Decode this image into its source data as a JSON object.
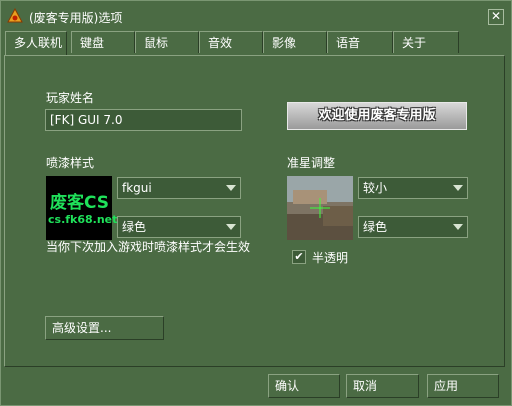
{
  "window": {
    "title": "(废客专用版)选项",
    "close_glyph": "✕"
  },
  "tabs": [
    {
      "label": "多人联机",
      "active": true
    },
    {
      "label": "键盘"
    },
    {
      "label": "鼠标"
    },
    {
      "label": "音效"
    },
    {
      "label": "影像"
    },
    {
      "label": "语音"
    },
    {
      "label": "关于"
    }
  ],
  "player": {
    "label": "玩家姓名",
    "value": "[FK] GUI 7.0"
  },
  "banner": {
    "text": "欢迎使用废客专用版"
  },
  "spray": {
    "label": "喷漆样式",
    "preview_title": "废客CS",
    "preview_url": "cs.fk68.net",
    "style_value": "fkgui",
    "color_value": "绿色",
    "note": "当你下次加入游戏时喷漆样式才会生效"
  },
  "crosshair": {
    "label": "准星调整",
    "size_value": "较小",
    "color_value": "绿色",
    "translucent_label": "半透明",
    "translucent_checked": true
  },
  "advanced_button": "高级设置...",
  "footer": {
    "ok": "确认",
    "cancel": "取消",
    "apply": "应用"
  },
  "colors": {
    "background": "#4b6b44",
    "field": "#3d5b38",
    "spray_text": "#1fe15a",
    "crosshair": "#3cff3c"
  },
  "icons": {
    "app": "cs-logo-icon",
    "close": "close-icon",
    "dropdown": "chevron-down-icon",
    "checkbox": "checkmark-icon"
  }
}
